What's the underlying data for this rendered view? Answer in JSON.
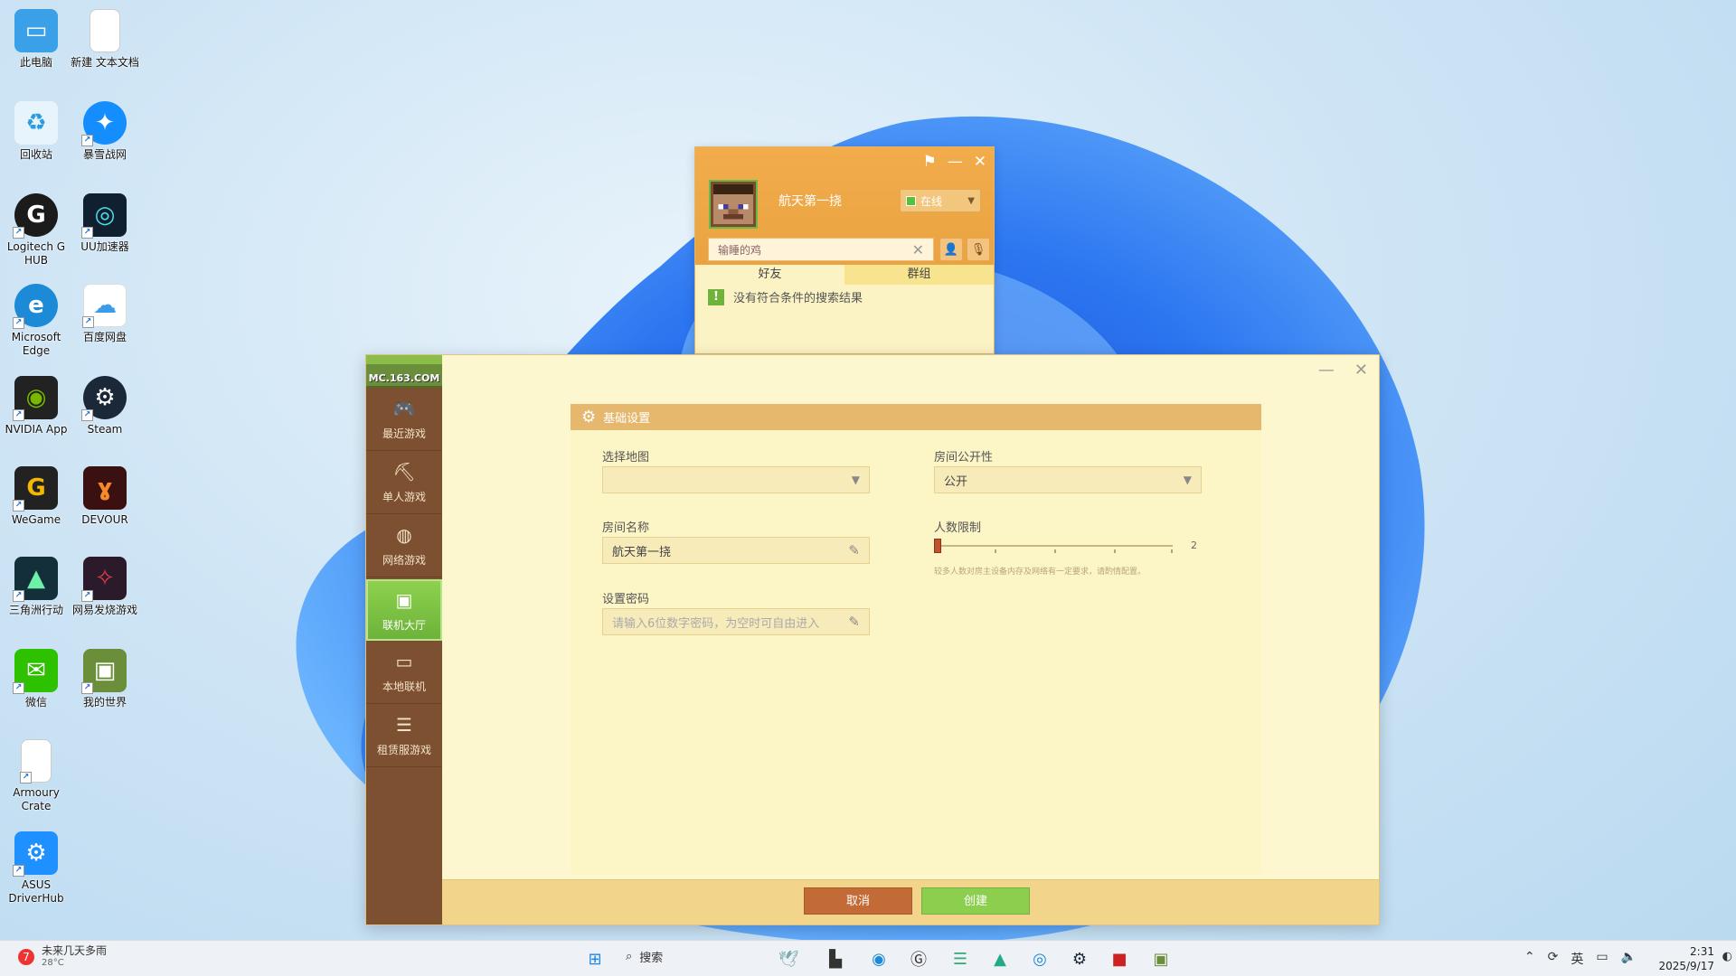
{
  "desktop": {
    "icons": [
      {
        "label": "此电脑",
        "icon": "monitor-icon",
        "color": "#3aa0e8"
      },
      {
        "label": "新建 文本文档",
        "icon": "text-file-icon",
        "color": "#ffffff"
      },
      {
        "label": "回收站",
        "icon": "recycle-bin-icon",
        "color": "#ffffff"
      },
      {
        "label": "暴雪战网",
        "icon": "battlenet-icon",
        "color": "#148eff"
      },
      {
        "label": "Logitech G HUB",
        "icon": "logitech-icon",
        "color": "#1b1b1b"
      },
      {
        "label": "UU加速器",
        "icon": "uu-icon",
        "color": "#102030"
      },
      {
        "label": "Microsoft Edge",
        "icon": "edge-icon",
        "color": "#1c8ad6"
      },
      {
        "label": "百度网盘",
        "icon": "baidu-netdisk-icon",
        "color": "#ffffff"
      },
      {
        "label": "NVIDIA App",
        "icon": "nvidia-icon",
        "color": "#222222"
      },
      {
        "label": "Steam",
        "icon": "steam-icon",
        "color": "#1b2838"
      },
      {
        "label": "WeGame",
        "icon": "wegame-icon",
        "color": "#222222"
      },
      {
        "label": "DEVOUR",
        "icon": "devour-icon",
        "color": "#3a1010"
      },
      {
        "label": "三角洲行动",
        "icon": "delta-force-icon",
        "color": "#13303a"
      },
      {
        "label": "网易发烧游戏",
        "icon": "netease-game-icon",
        "color": "#2a1a2a"
      },
      {
        "label": "微信",
        "icon": "wechat-icon",
        "color": "#2dc100"
      },
      {
        "label": "我的世界",
        "icon": "minecraft-icon",
        "color": "#6b8e3a"
      },
      {
        "label": "Armoury Crate",
        "icon": "file-icon",
        "color": "#ffffff"
      },
      {
        "label": "ASUS DriverHub",
        "icon": "asus-driverhub-icon",
        "color": "#1e90ff"
      }
    ]
  },
  "qq_panel": {
    "username": "航天第一挠",
    "status": "在线",
    "search_value": "输睡的鸡",
    "tabs": [
      "好友",
      "群组"
    ],
    "message": "没有符合条件的搜索结果"
  },
  "launcher": {
    "logo": "MC.163.COM",
    "nav": [
      {
        "label": "最近游戏",
        "icon": "gamepad-icon"
      },
      {
        "label": "单人游戏",
        "icon": "pickaxe-icon"
      },
      {
        "label": "网络游戏",
        "icon": "globe-icon"
      },
      {
        "label": "联机大厅",
        "icon": "lobby-icon",
        "active": true
      },
      {
        "label": "本地联机",
        "icon": "lan-icon"
      },
      {
        "label": "租赁服游戏",
        "icon": "server-list-icon"
      }
    ],
    "section_title": "基础设置",
    "map_label": "选择地图",
    "map_value": "",
    "visibility_label": "房间公开性",
    "visibility_value": "公开",
    "room_name_label": "房间名称",
    "room_name_value": "航天第一挠",
    "player_limit_label": "人数限制",
    "player_limit_value": "2",
    "player_limit_fraction": 0.0,
    "player_limit_hint": "较多人数对房主设备内存及网络有一定要求，请酌情配置。",
    "password_label": "设置密码",
    "password_placeholder": "请输入6位数字密码，为空时可自由进入",
    "cancel_label": "取消",
    "create_label": "创建"
  },
  "taskbar": {
    "weather_text": "未来几天多雨",
    "weather_temp": "28°C",
    "search_label": "搜索",
    "tray_lang": "英",
    "time": "2:31",
    "date": "2025/9/17"
  }
}
